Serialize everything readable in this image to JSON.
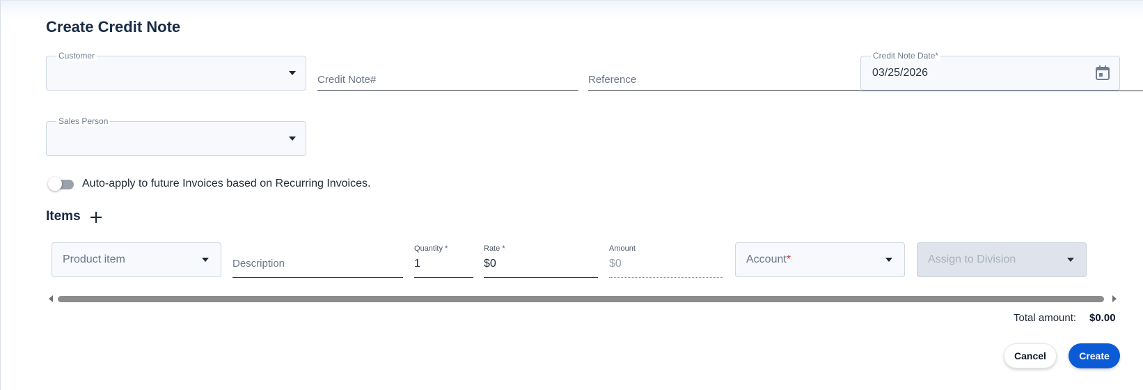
{
  "page": {
    "title": "Create Credit Note"
  },
  "header_form": {
    "customer": {
      "label": "Customer",
      "value": ""
    },
    "credit_note_number": {
      "placeholder": "Credit Note#"
    },
    "reference": {
      "placeholder": "Reference"
    },
    "credit_note_date": {
      "label": "Credit Note Date*",
      "value": "03/25/2026",
      "icon": "calendar-icon"
    },
    "sales_person": {
      "label": "Sales Person",
      "value": ""
    }
  },
  "auto_apply": {
    "label": "Auto-apply to future Invoices based on Recurring Invoices.",
    "enabled": false
  },
  "items": {
    "title": "Items",
    "add_icon": "plus-icon",
    "row": {
      "product_item": {
        "placeholder": "Product item"
      },
      "description": {
        "placeholder": "Description"
      },
      "quantity": {
        "label": "Quantity *",
        "value": "1"
      },
      "rate": {
        "label": "Rate *",
        "value": "$0"
      },
      "amount": {
        "label": "Amount",
        "value": "$0"
      },
      "account": {
        "placeholder": "Account",
        "required_mark": "*"
      },
      "division": {
        "placeholder": "Assign to Division",
        "disabled": true
      }
    }
  },
  "totals": {
    "label": "Total amount:",
    "value": "$0.00"
  },
  "actions": {
    "cancel_label": "Cancel",
    "create_label": "Create"
  },
  "colors": {
    "primary": "#0b5bd7",
    "title": "#182b45",
    "required": "#d32f2f",
    "disabled_field": "#dfe4ec"
  }
}
